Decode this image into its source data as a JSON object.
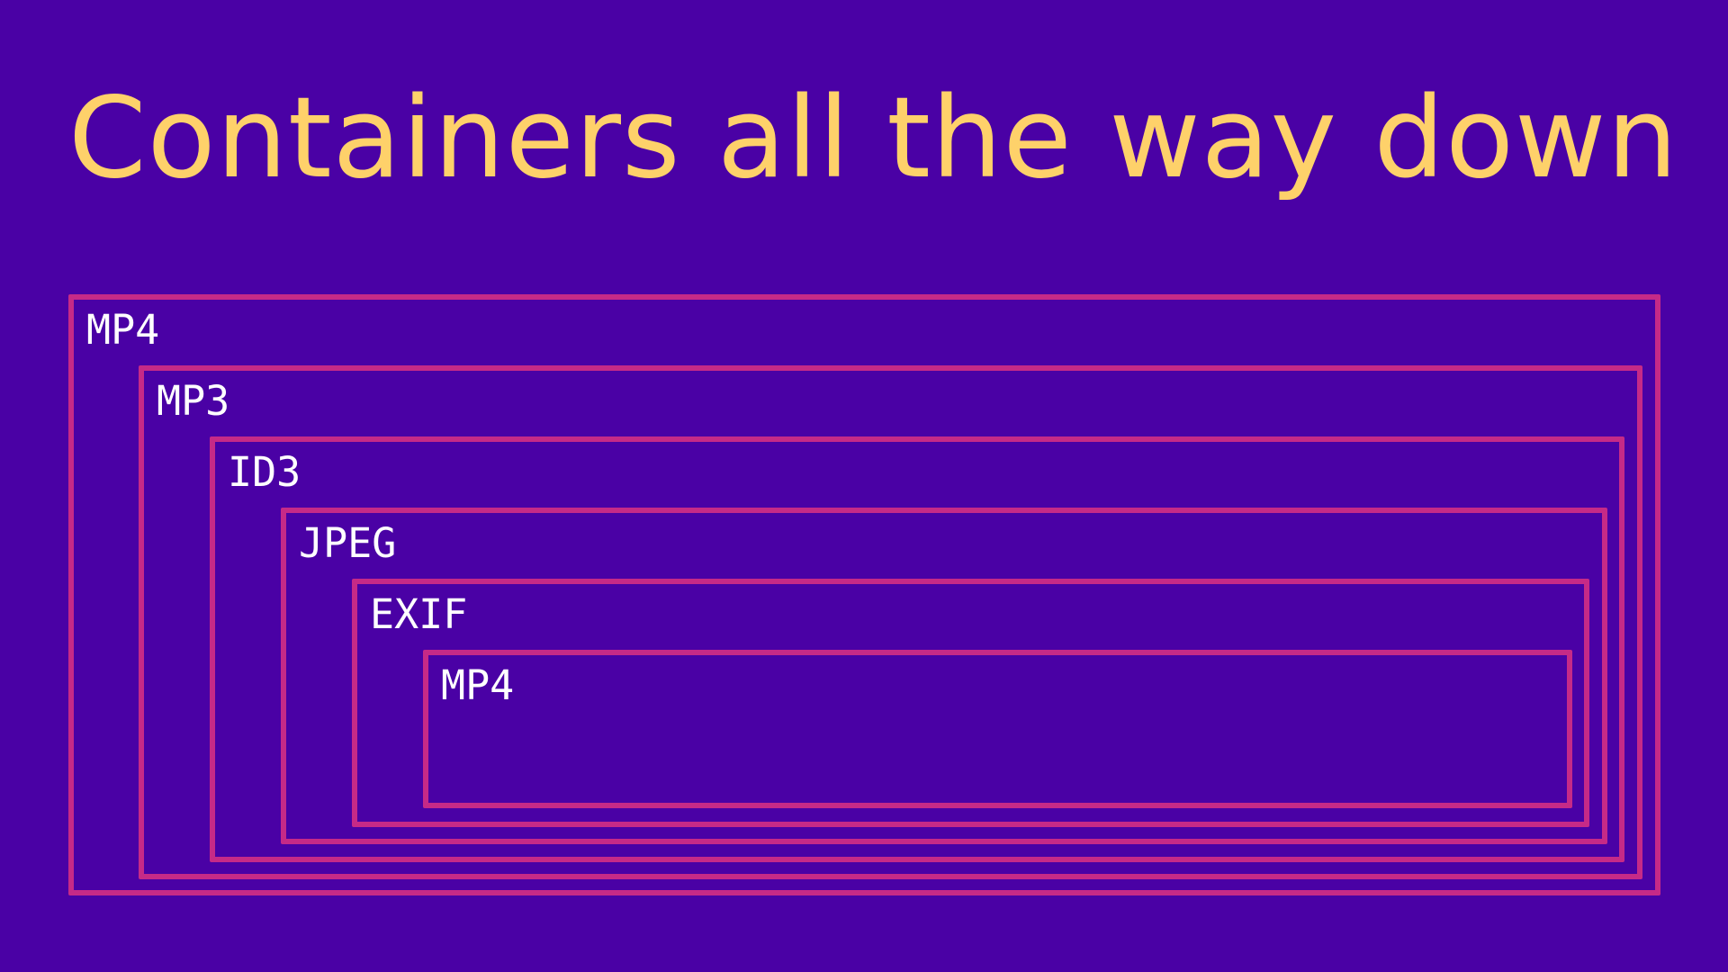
{
  "slide": {
    "title": "Containers all the way down"
  },
  "containers": [
    {
      "label": "MP4"
    },
    {
      "label": "MP3"
    },
    {
      "label": "ID3"
    },
    {
      "label": "JPEG"
    },
    {
      "label": "EXIF"
    },
    {
      "label": "MP4"
    }
  ],
  "colors": {
    "background": "#4a01a5",
    "title": "#fed16a",
    "box_border": "#c62a87",
    "label": "#ffffff"
  }
}
